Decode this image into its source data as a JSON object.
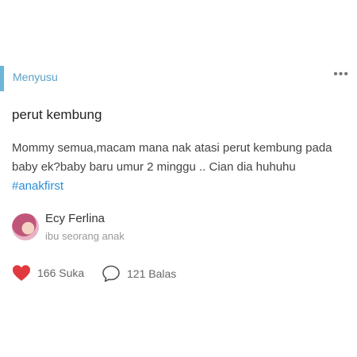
{
  "post": {
    "category": "Menyusu",
    "more": "•••",
    "title": "perut kembung",
    "body": "Mommy semua,macam mana nak atasi perut kembung pada baby ek?baby baru umur 2 minggu .. Cian dia huhuhu ",
    "hashtag": "#anakfirst",
    "author": {
      "name": "Ecy Ferlina",
      "subtitle": "ibu seorang anak"
    },
    "stats": {
      "likes": "166 Suka",
      "replies": "121 Balas"
    }
  },
  "colors": {
    "accent": "#6cb6d9",
    "hashtag": "#2a8fd7",
    "heart": "#e0393e"
  },
  "icons": {
    "like": "heart-icon",
    "reply": "speech-bubble-icon",
    "more": "ellipsis-icon"
  }
}
